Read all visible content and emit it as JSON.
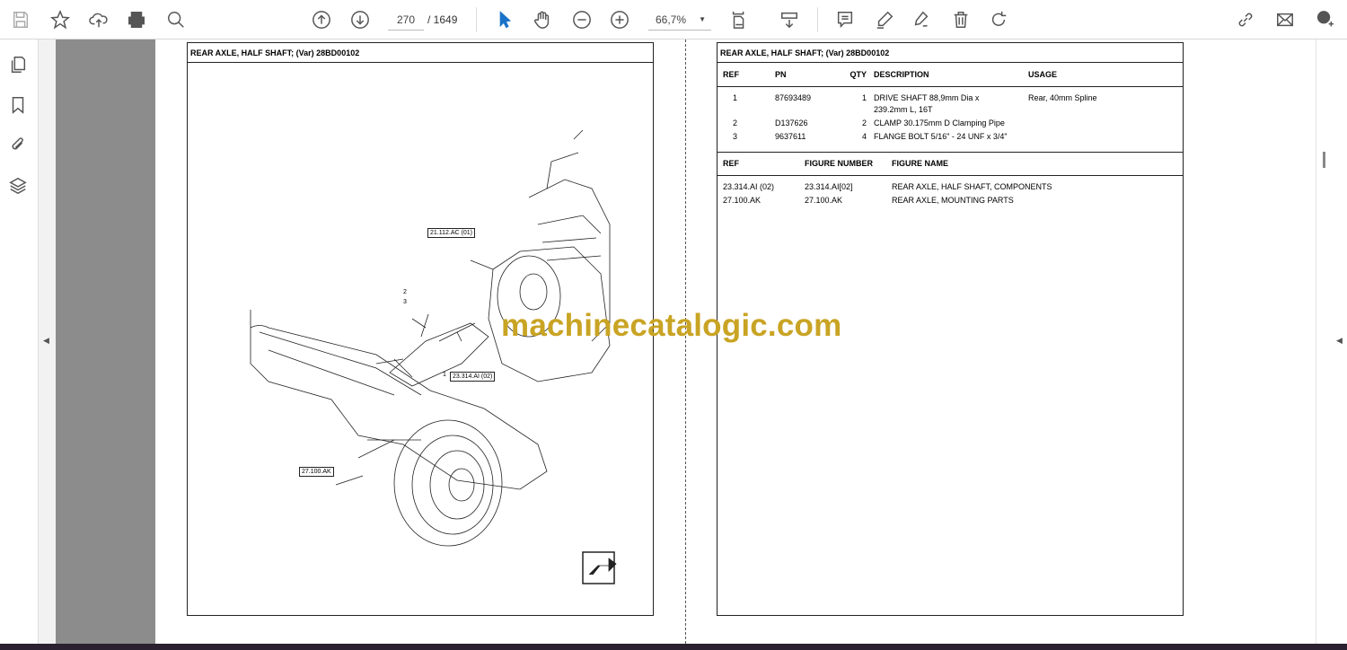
{
  "toolbar": {
    "page_current": "270",
    "page_total": "/ 1649",
    "zoom": "66,7%"
  },
  "left_page": {
    "title": "REAR AXLE, HALF SHAFT; (Var) 28BD00102",
    "callouts": [
      "21.112.AC (01)",
      "23.314.AI (02)",
      "27.100.AK"
    ],
    "refs": [
      "1",
      "2",
      "3"
    ]
  },
  "right_page": {
    "title": "REAR AXLE, HALF SHAFT; (Var) 28BD00102",
    "parts_headers": [
      "REF",
      "PN",
      "QTY",
      "DESCRIPTION",
      "USAGE"
    ],
    "parts": [
      {
        "ref": "1",
        "pn": "87693489",
        "qty": "1",
        "desc": "DRIVE SHAFT 88,9mm Dia x",
        "desc2": "239.2mm L, 16T",
        "usage": "Rear, 40mm Spline"
      },
      {
        "ref": "2",
        "pn": "D137626",
        "qty": "2",
        "desc": "CLAMP 30.175mm D Clamping Pipe",
        "desc2": "",
        "usage": ""
      },
      {
        "ref": "3",
        "pn": "9637611",
        "qty": "4",
        "desc": "FLANGE BOLT 5/16\" - 24 UNF x 3/4\"",
        "desc2": "",
        "usage": ""
      }
    ],
    "fig_headers": [
      "REF",
      "FIGURE NUMBER",
      "FIGURE NAME"
    ],
    "figures": [
      {
        "ref": "23.314.AI (02)",
        "num": "23.314.AI[02]",
        "name": "REAR AXLE, HALF SHAFT, COMPONENTS"
      },
      {
        "ref": "27.100.AK",
        "num": "27.100.AK",
        "name": "REAR AXLE, MOUNTING PARTS"
      }
    ]
  },
  "watermark": "machinecatalogic.com",
  "colors": {
    "watermark": "#c9a424",
    "select_tool": "#1a73c8"
  }
}
